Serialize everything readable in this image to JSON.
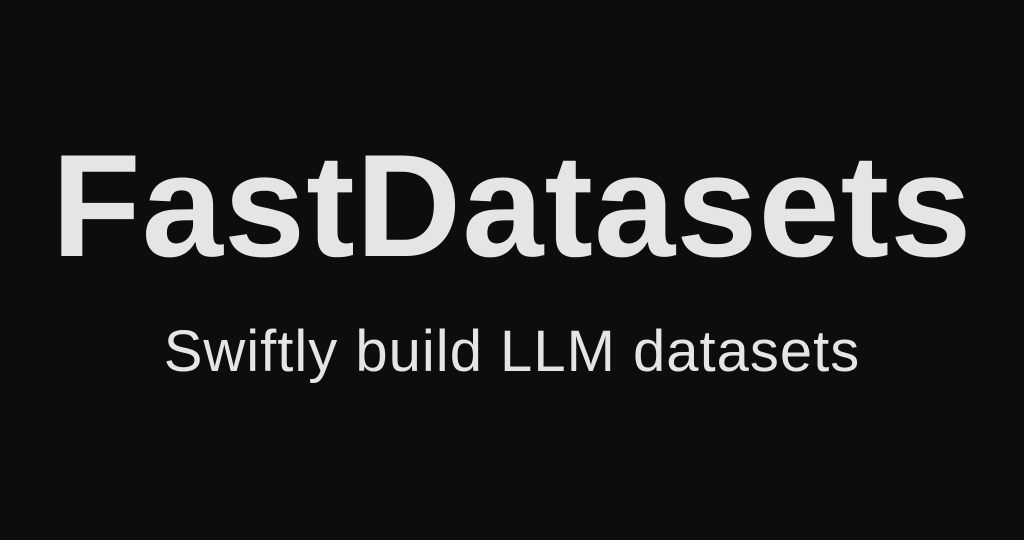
{
  "hero": {
    "title": "FastDatasets",
    "subtitle": "Swiftly build LLM datasets"
  },
  "colors": {
    "background": "#0d0d0d",
    "text": "#e5e5e5"
  }
}
